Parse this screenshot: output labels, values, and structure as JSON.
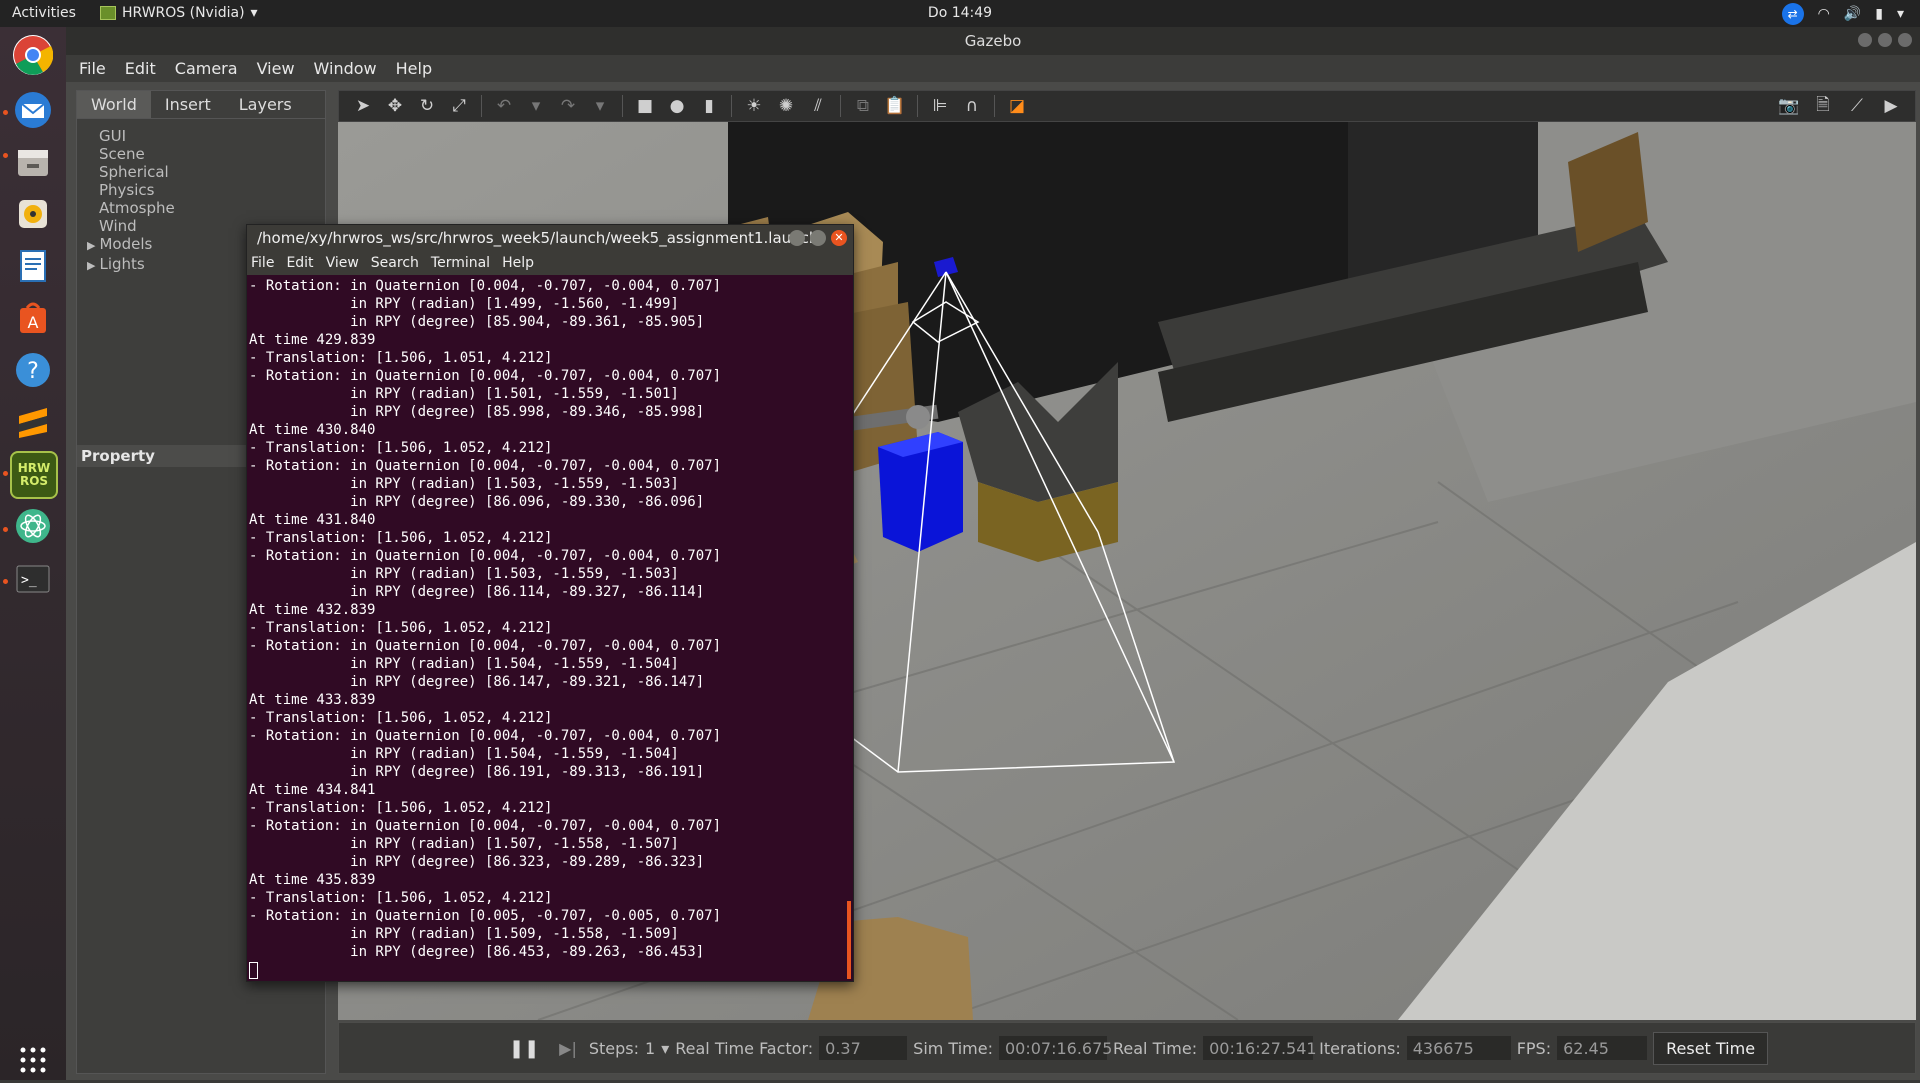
{
  "topbar": {
    "activities": "Activities",
    "app_name": "HRWROS (Nvidia)",
    "clock": "Do 14:49"
  },
  "dock": {
    "items": [
      "chrome-icon",
      "thunderbird-icon",
      "files-icon",
      "rhythmbox-icon",
      "writer-icon",
      "software-center-icon",
      "help-icon",
      "sublime-icon",
      "hrwros-icon",
      "atom-icon",
      "terminal-icon",
      "app-grid-icon"
    ],
    "hrwros_label": "HRW\nROS"
  },
  "gazebo": {
    "title": "Gazebo",
    "menu": [
      "File",
      "Edit",
      "Camera",
      "View",
      "Window",
      "Help"
    ],
    "tabs": [
      "World",
      "Insert",
      "Layers"
    ],
    "tree": [
      "GUI",
      "Scene",
      "Spherical",
      "Physics",
      "Atmosphe",
      "Wind",
      "Models",
      "Lights"
    ],
    "property_label": "Property",
    "bottom": {
      "steps_label": "Steps:",
      "steps_value": "1",
      "rtf_label": "Real Time Factor:",
      "rtf_value": "0.37",
      "sim_time_label": "Sim Time:",
      "sim_time_value": "00:07:16.675",
      "real_time_label": "Real Time:",
      "real_time_value": "00:16:27.541",
      "iterations_label": "Iterations:",
      "iterations_value": "436675",
      "fps_label": "FPS:",
      "fps_value": "62.45",
      "reset_label": "Reset Time"
    }
  },
  "terminal": {
    "title": "/home/xy/hrwros_ws/src/hrwros_week5/launch/week5_assignment1.launch",
    "menu": [
      "File",
      "Edit",
      "View",
      "Search",
      "Terminal",
      "Help"
    ],
    "lines": [
      "- Rotation: in Quaternion [0.004, -0.707, -0.004, 0.707]",
      "            in RPY (radian) [1.499, -1.560, -1.499]",
      "            in RPY (degree) [85.904, -89.361, -85.905]",
      "At time 429.839",
      "- Translation: [1.506, 1.051, 4.212]",
      "- Rotation: in Quaternion [0.004, -0.707, -0.004, 0.707]",
      "            in RPY (radian) [1.501, -1.559, -1.501]",
      "            in RPY (degree) [85.998, -89.346, -85.998]",
      "At time 430.840",
      "- Translation: [1.506, 1.052, 4.212]",
      "- Rotation: in Quaternion [0.004, -0.707, -0.004, 0.707]",
      "            in RPY (radian) [1.503, -1.559, -1.503]",
      "            in RPY (degree) [86.096, -89.330, -86.096]",
      "At time 431.840",
      "- Translation: [1.506, 1.052, 4.212]",
      "- Rotation: in Quaternion [0.004, -0.707, -0.004, 0.707]",
      "            in RPY (radian) [1.503, -1.559, -1.503]",
      "            in RPY (degree) [86.114, -89.327, -86.114]",
      "At time 432.839",
      "- Translation: [1.506, 1.052, 4.212]",
      "- Rotation: in Quaternion [0.004, -0.707, -0.004, 0.707]",
      "            in RPY (radian) [1.504, -1.559, -1.504]",
      "            in RPY (degree) [86.147, -89.321, -86.147]",
      "At time 433.839",
      "- Translation: [1.506, 1.052, 4.212]",
      "- Rotation: in Quaternion [0.004, -0.707, -0.004, 0.707]",
      "            in RPY (radian) [1.504, -1.559, -1.504]",
      "            in RPY (degree) [86.191, -89.313, -86.191]",
      "At time 434.841",
      "- Translation: [1.506, 1.052, 4.212]",
      "- Rotation: in Quaternion [0.004, -0.707, -0.004, 0.707]",
      "            in RPY (radian) [1.507, -1.558, -1.507]",
      "            in RPY (degree) [86.323, -89.289, -86.323]",
      "At time 435.839",
      "- Translation: [1.506, 1.052, 4.212]",
      "- Rotation: in Quaternion [0.005, -0.707, -0.005, 0.707]",
      "            in RPY (radian) [1.509, -1.558, -1.509]",
      "            in RPY (degree) [86.453, -89.263, -86.453]"
    ]
  },
  "colors": {
    "terminal_bg": "#300a24",
    "ubuntu_orange": "#e95420",
    "sensor_frustum": "#ffffff",
    "bin_blue": "#0a14d8"
  }
}
